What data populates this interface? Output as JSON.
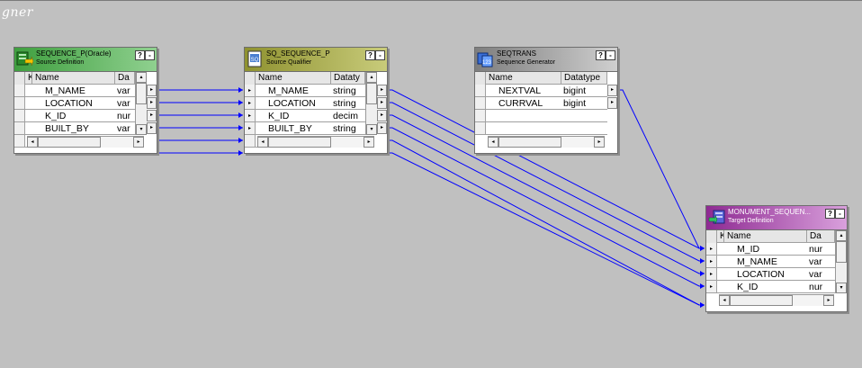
{
  "canvas": {
    "title": "gner"
  },
  "transforms": {
    "source": {
      "title": "SEQUENCE_P(Oracle)",
      "subtitle": "Source Definition",
      "header_color": "#6abf6a",
      "columns": [
        "K",
        "Name",
        "Da"
      ],
      "rows": [
        {
          "name": "M_NAME",
          "type": "var"
        },
        {
          "name": "LOCATION",
          "type": "var"
        },
        {
          "name": "K_ID",
          "type": "nur"
        },
        {
          "name": "BUILT_BY",
          "type": "var"
        }
      ]
    },
    "qualifier": {
      "title": "SQ_SEQUENCE_P",
      "subtitle": "Source Qualifier",
      "header_color": "#a9ad55",
      "columns": [
        "Name",
        "Dataty"
      ],
      "rows": [
        {
          "name": "M_NAME",
          "type": "string"
        },
        {
          "name": "LOCATION",
          "type": "string"
        },
        {
          "name": "K_ID",
          "type": "decim"
        },
        {
          "name": "BUILT_BY",
          "type": "string"
        }
      ]
    },
    "seqgen": {
      "title": "SEQTRANS",
      "subtitle": "Sequence Generator",
      "header_color": "#9a9a9a",
      "columns": [
        "Name",
        "Datatype"
      ],
      "rows": [
        {
          "name": "NEXTVAL",
          "type": "bigint"
        },
        {
          "name": "CURRVAL",
          "type": "bigint"
        }
      ]
    },
    "target": {
      "title": "MONUMENT_SEQUEN...",
      "subtitle": "Target Definition",
      "header_color": "#b44fb8",
      "columns": [
        "K",
        "Name",
        "Da"
      ],
      "rows": [
        {
          "name": "M_ID",
          "type": "nur"
        },
        {
          "name": "M_NAME",
          "type": "var"
        },
        {
          "name": "LOCATION",
          "type": "var"
        },
        {
          "name": "K_ID",
          "type": "nur"
        }
      ]
    }
  },
  "buttons": {
    "help": "?",
    "minimize": "-",
    "port_arrow": "▸",
    "scroll_up": "▴",
    "scroll_down": "▾",
    "scroll_left": "◂",
    "scroll_right": "▸"
  },
  "colors": {
    "link": "#0000ff",
    "canvas": "#c0c0c0"
  }
}
